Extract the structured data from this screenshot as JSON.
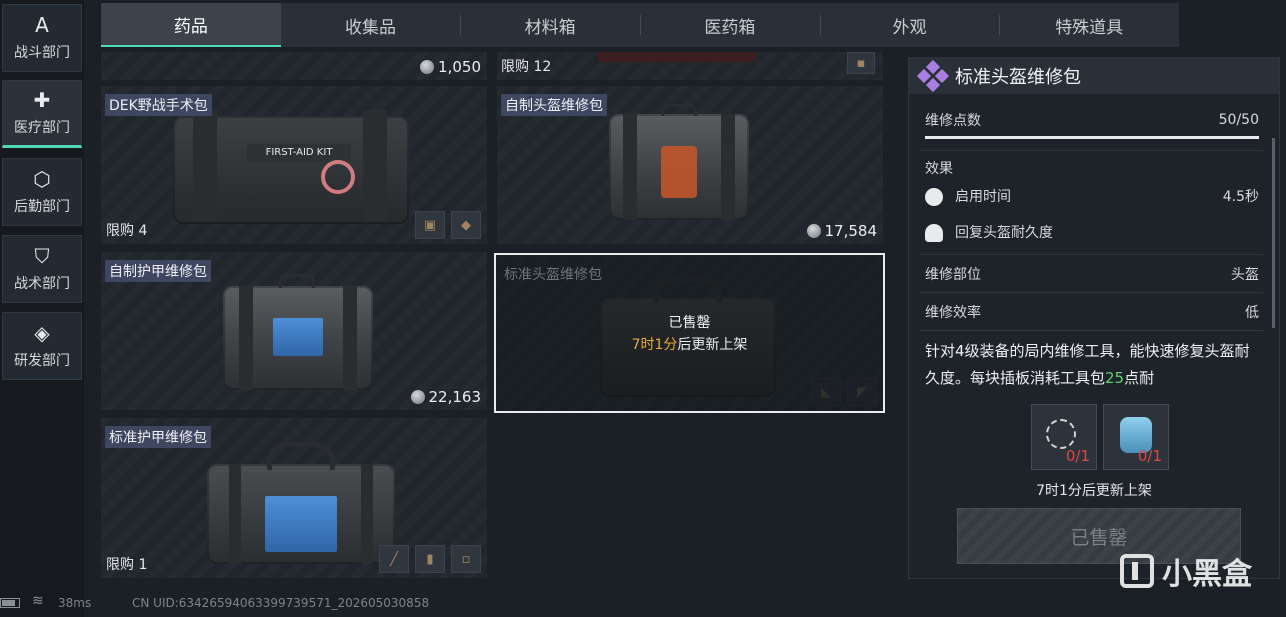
{
  "sidebar": {
    "items": [
      {
        "label": "战斗部门",
        "icon": "combat-icon",
        "glyph": "A"
      },
      {
        "label": "医疗部门",
        "icon": "medical-cross-icon",
        "glyph": "✚"
      },
      {
        "label": "后勤部门",
        "icon": "logistics-icon",
        "glyph": "⬡"
      },
      {
        "label": "战术部门",
        "icon": "tactical-shield-icon",
        "glyph": "⛉"
      },
      {
        "label": "研发部门",
        "icon": "research-icon",
        "glyph": "◈"
      }
    ]
  },
  "tabs": [
    "药品",
    "收集品",
    "材料箱",
    "医药箱",
    "外观",
    "特殊道具"
  ],
  "accent_color": "#4fd9b5",
  "items": {
    "top_left_price": "1,050",
    "top_right_limit": "限购 12",
    "dek": {
      "name": "DEK野战手术包",
      "limit": "限购 4",
      "kit_text": "FIRST-AID KIT"
    },
    "helmet_diy": {
      "name": "自制头盔维修包",
      "price": "17,584"
    },
    "armor_diy": {
      "name": "自制护甲维修包",
      "price": "22,163"
    },
    "helmet_std": {
      "name": "标准头盔维修包",
      "sold": "已售罄",
      "timer_hl": "7时1分",
      "timer_rest": "后更新上架"
    },
    "armor_std": {
      "name": "标准护甲维修包",
      "limit": "限购 1"
    }
  },
  "detail": {
    "title": "标准头盔维修包",
    "repair_points_label": "维修点数",
    "repair_points_value": "50/50",
    "repair_fraction": 1.0,
    "effects_label": "效果",
    "activate_label": "启用时间",
    "activate_value": "4.5秒",
    "restore_label": "回复头盔耐久度",
    "part_label": "维修部位",
    "part_value": "头盔",
    "efficiency_label": "维修效率",
    "efficiency_value": "低",
    "desc_part1": "针对4级装备的局内维修工具，能快速修复头盔耐久度。每块插板消耗工具包",
    "desc_green": "25",
    "desc_part2": "点耐",
    "req1_count": "0/1",
    "req2_count": "0/1",
    "restock": "7时1分后更新上架",
    "button": "已售罄"
  },
  "footer": {
    "ping": "38ms",
    "uid": "CN UID:63426594063399739571_202605030858"
  },
  "watermark": "小黑盒"
}
